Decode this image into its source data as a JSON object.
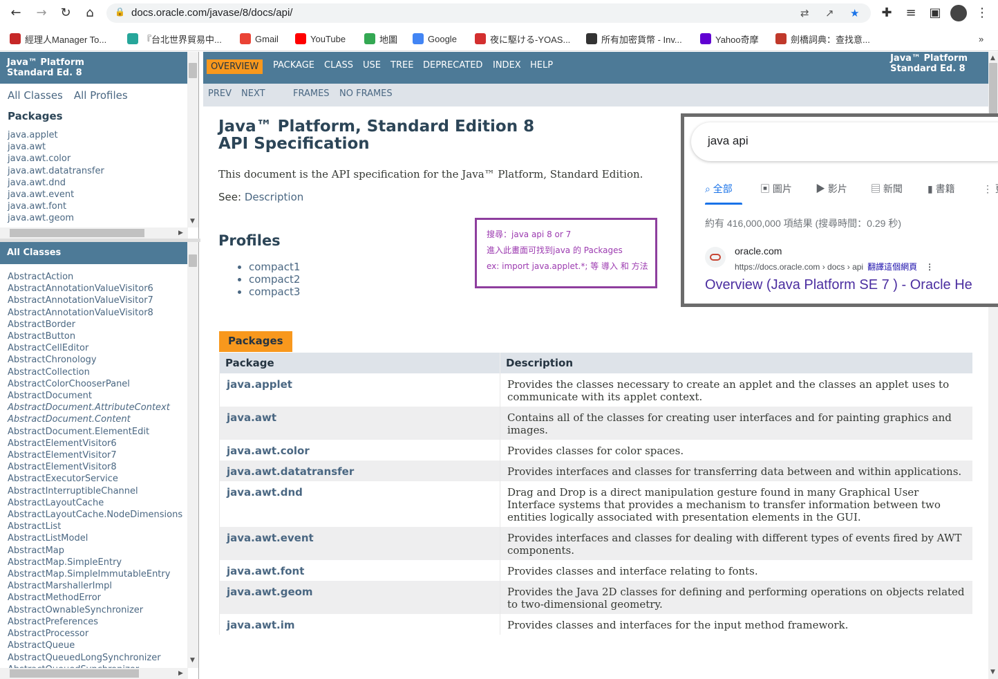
{
  "browser": {
    "url": "docs.oracle.com/javase/8/docs/api/",
    "bookmarks": [
      {
        "label": "經理人Manager To...",
        "color": "#c62828"
      },
      {
        "label": "『台北世界貿易中...",
        "color": "#26a69a"
      },
      {
        "label": "Gmail",
        "color": "#ea4335"
      },
      {
        "label": "YouTube",
        "color": "#ff0000"
      },
      {
        "label": "地圖",
        "color": "#34a853"
      },
      {
        "label": "Google",
        "color": "#4285f4"
      },
      {
        "label": "夜に駆ける-YOAS...",
        "color": "#d32f2f"
      },
      {
        "label": "所有加密貨幣 - Inv...",
        "color": "#333333"
      },
      {
        "label": "Yahoo奇摩",
        "color": "#6001d2"
      },
      {
        "label": "劍橋詞典：查找意...",
        "color": "#c0392b"
      }
    ]
  },
  "left_top": {
    "header": [
      "Java™ Platform",
      "Standard Ed. 8"
    ],
    "links": [
      "All Classes",
      "All Profiles"
    ],
    "packages_title": "Packages",
    "packages": [
      "java.applet",
      "java.awt",
      "java.awt.color",
      "java.awt.datatransfer",
      "java.awt.dnd",
      "java.awt.event",
      "java.awt.font",
      "java.awt.geom"
    ]
  },
  "left_bottom": {
    "header": "All Classes",
    "classes": [
      "AbstractAction",
      "AbstractAnnotationValueVisitor6",
      "AbstractAnnotationValueVisitor7",
      "AbstractAnnotationValueVisitor8",
      "AbstractBorder",
      "AbstractButton",
      "AbstractCellEditor",
      "AbstractChronology",
      "AbstractCollection",
      "AbstractColorChooserPanel",
      "AbstractDocument",
      "AbstractDocument.AttributeContext",
      "AbstractDocument.Content",
      "AbstractDocument.ElementEdit",
      "AbstractElementVisitor6",
      "AbstractElementVisitor7",
      "AbstractElementVisitor8",
      "AbstractExecutorService",
      "AbstractInterruptibleChannel",
      "AbstractLayoutCache",
      "AbstractLayoutCache.NodeDimensions",
      "AbstractList",
      "AbstractListModel",
      "AbstractMap",
      "AbstractMap.SimpleEntry",
      "AbstractMap.SimpleImmutableEntry",
      "AbstractMarshallerImpl",
      "AbstractMethodError",
      "AbstractOwnableSynchronizer",
      "AbstractPreferences",
      "AbstractProcessor",
      "AbstractQueue",
      "AbstractQueuedLongSynchronizer",
      "AbstractQueuedSynchronizer"
    ],
    "italic": [
      "AbstractDocument.AttributeContext",
      "AbstractDocument.Content"
    ]
  },
  "nav": {
    "items": [
      "OVERVIEW",
      "PACKAGE",
      "CLASS",
      "USE",
      "TREE",
      "DEPRECATED",
      "INDEX",
      "HELP"
    ],
    "brand": [
      "Java™ Platform",
      "Standard Ed. 8"
    ],
    "sub": [
      "PREV",
      "NEXT",
      "FRAMES",
      "NO FRAMES"
    ]
  },
  "main": {
    "title1": "Java™ Platform, Standard Edition 8",
    "title2": "API Specification",
    "intro": "This document is the API specification for the Java™ Platform, Standard Edition.",
    "see_label": "See:",
    "see_link": "Description",
    "profiles_title": "Profiles",
    "profiles": [
      "compact1",
      "compact2",
      "compact3"
    ],
    "packages_tab": "Packages",
    "col_package": "Package",
    "col_description": "Description",
    "rows": [
      {
        "name": "java.applet",
        "desc": "Provides the classes necessary to create an applet and the classes an applet uses to communicate with its applet context."
      },
      {
        "name": "java.awt",
        "desc": "Contains all of the classes for creating user interfaces and for painting graphics and images."
      },
      {
        "name": "java.awt.color",
        "desc": "Provides classes for color spaces."
      },
      {
        "name": "java.awt.datatransfer",
        "desc": "Provides interfaces and classes for transferring data between and within applications."
      },
      {
        "name": "java.awt.dnd",
        "desc": "Drag and Drop is a direct manipulation gesture found in many Graphical User Interface systems that provides a mechanism to transfer information between two entities logically associated with presentation elements in the GUI."
      },
      {
        "name": "java.awt.event",
        "desc": "Provides interfaces and classes for dealing with different types of events fired by AWT components."
      },
      {
        "name": "java.awt.font",
        "desc": "Provides classes and interface relating to fonts."
      },
      {
        "name": "java.awt.geom",
        "desc": "Provides the Java 2D classes for defining and performing operations on objects related to two-dimensional geometry."
      },
      {
        "name": "java.awt.im",
        "desc": "Provides classes and interfaces for the input method framework."
      }
    ]
  },
  "note": {
    "lines": [
      "搜尋：java api 8 or 7",
      "進入此畫面可找到java 的 Packages",
      "ex: import java.applet.*; 等 導入 和 方法"
    ]
  },
  "google": {
    "query": "java api",
    "tabs": [
      "全部",
      "圖片",
      "影片",
      "新聞",
      "書籍",
      "更"
    ],
    "count": "約有 416,000,000 項結果 (搜尋時間：0.29 秒)",
    "site": "oracle.com",
    "url": "https://docs.oracle.com › docs › api",
    "translate": "翻譯這個網頁",
    "title": "Overview (Java Platform SE 7 ) - Oracle He"
  }
}
